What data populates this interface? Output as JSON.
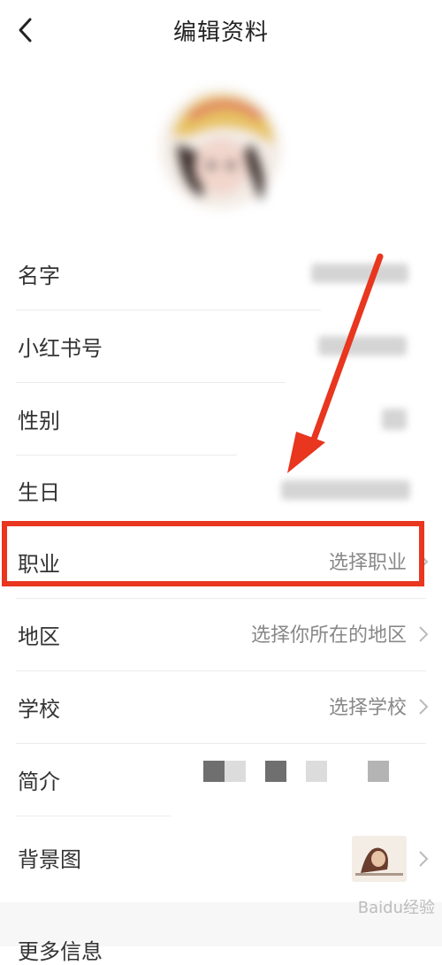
{
  "header": {
    "title": "编辑资料",
    "back_icon": "chevron-left-icon"
  },
  "rows": [
    {
      "label": "名字",
      "value": ""
    },
    {
      "label": "小红书号",
      "value": ""
    },
    {
      "label": "性别",
      "value": ""
    },
    {
      "label": "生日",
      "value": ""
    },
    {
      "label": "职业",
      "value": "选择职业"
    },
    {
      "label": "地区",
      "value": "选择你所在的地区"
    },
    {
      "label": "学校",
      "value": "选择学校"
    },
    {
      "label": "简介",
      "value": ""
    },
    {
      "label": "背景图",
      "value": ""
    }
  ],
  "more_section": {
    "label": "更多信息"
  },
  "watermark": "Baidu经验",
  "colors": {
    "annotation_red": "#e8361f",
    "value_gray": "#888888"
  }
}
